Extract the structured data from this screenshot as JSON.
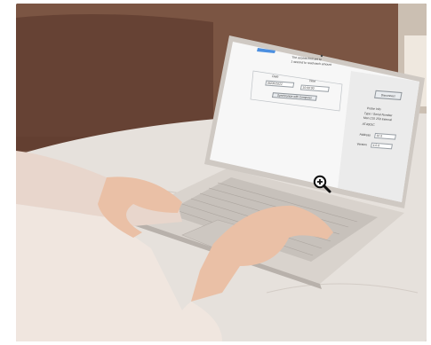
{
  "screen": {
    "notice_line1": "The access limit set to",
    "notice_line2": "1 second to read each amount",
    "label_date": "Date",
    "label_time": "Time",
    "date_value": "06/05/2022",
    "time_value": "10:00:00",
    "sync_button": "Synchronize with Computer",
    "right_button": "Disconnect",
    "info_title": "Probe Info",
    "info_type": "Type / Serial Number",
    "info_model": "Mon 215 250 Internal",
    "info_id": "AT4001C",
    "address_label": "Address",
    "address_value": "10 0",
    "version_label": "Version",
    "version_value": "4.0.0"
  },
  "icons": {
    "cursor": "zoom-in-magnifier-icon"
  },
  "colors": {
    "background_wall": "#6e4a3a",
    "table_marble": "#e6e1dc",
    "laptop_body": "#d9d3cd",
    "screen_white": "#f7f7f7"
  }
}
